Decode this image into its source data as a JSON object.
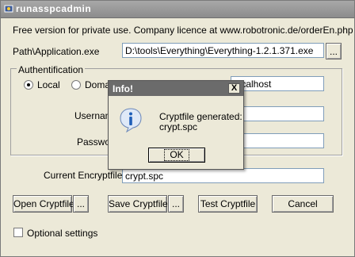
{
  "window": {
    "title": "runasspcadmin"
  },
  "info_text": "Free version for private use. Company licence at www.robotronic.de/orderEn.php",
  "path": {
    "label": "Path\\Application.exe",
    "value": "D:\\tools\\Everything\\Everything-1.2.1.371.exe",
    "browse_label": "..."
  },
  "auth": {
    "group_title": "Authentification",
    "radio_local": "Local",
    "radio_domain": "Doma",
    "local_selected": true,
    "field1_value": "localhost",
    "username_label": "Usernam",
    "password_label": "Passwor"
  },
  "encrypt": {
    "label": "Current Encryptfile",
    "value": "crypt.spc"
  },
  "buttons": {
    "open": "Open Cryptfile",
    "open_browse": "...",
    "save": "Save Cryptfile",
    "save_browse": "...",
    "test": "Test Cryptfile",
    "cancel": "Cancel"
  },
  "optional_settings_label": "Optional settings",
  "dialog": {
    "title": "Info!",
    "close_label": "X",
    "message_line1": "Cryptfile generated:",
    "message_line2": "crypt.spc",
    "ok_label": "OK"
  },
  "icons": {
    "app": "app-icon",
    "info": "info-icon",
    "close": "close-icon"
  }
}
